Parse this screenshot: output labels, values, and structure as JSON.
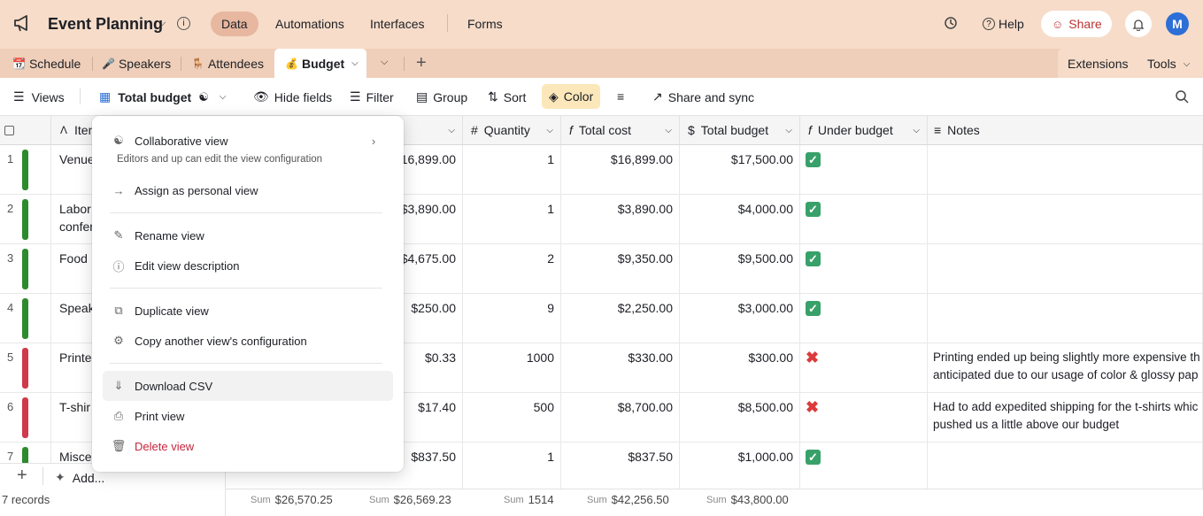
{
  "app": {
    "title": "Event Planning",
    "avatar": "M"
  },
  "topnav": {
    "data": "Data",
    "automations": "Automations",
    "interfaces": "Interfaces",
    "forms": "Forms",
    "help": "Help",
    "share": "Share"
  },
  "tabs": [
    {
      "label": "Schedule",
      "icon": "calendar-icon"
    },
    {
      "label": "Speakers",
      "icon": "microphone-icon"
    },
    {
      "label": "Attendees",
      "icon": "chair-icon"
    },
    {
      "label": "Budget",
      "icon": "money-bag-icon"
    }
  ],
  "tabbar_right": {
    "extensions": "Extensions",
    "tools": "Tools"
  },
  "toolbar": {
    "views": "Views",
    "view_name": "Total budget",
    "hide_fields": "Hide fields",
    "filter": "Filter",
    "group": "Group",
    "sort": "Sort",
    "color": "Color",
    "share_sync": "Share and sync"
  },
  "columns": {
    "item": "Item",
    "quantity": "Quantity",
    "total_cost": "Total cost",
    "total_budget": "Total budget",
    "under_budget": "Under budget",
    "notes": "Notes"
  },
  "rows": [
    {
      "n": "1",
      "item": "Venue",
      "item2": "",
      "color": "#2d8a2d",
      "cost": "$16,899.00",
      "qty": "1",
      "total": "$16,899.00",
      "budget": "$17,500.00",
      "ok": true,
      "notes": "",
      "notes2": ""
    },
    {
      "n": "2",
      "item": "Labor",
      "item2": "confer",
      "color": "#2d8a2d",
      "cost": "$3,890.00",
      "qty": "1",
      "total": "$3,890.00",
      "budget": "$4,000.00",
      "ok": true,
      "notes": "",
      "notes2": ""
    },
    {
      "n": "3",
      "item": "Food",
      "item2": "",
      "color": "#2d8a2d",
      "cost": "$4,675.00",
      "qty": "2",
      "total": "$9,350.00",
      "budget": "$9,500.00",
      "ok": true,
      "notes": "",
      "notes2": ""
    },
    {
      "n": "4",
      "item": "Speak",
      "item2": "",
      "color": "#2d8a2d",
      "cost": "$250.00",
      "qty": "9",
      "total": "$2,250.00",
      "budget": "$3,000.00",
      "ok": true,
      "notes": "",
      "notes2": ""
    },
    {
      "n": "5",
      "item": "Printe",
      "item2": "",
      "color": "#d03a4a",
      "cost": "$0.33",
      "qty": "1000",
      "total": "$330.00",
      "budget": "$300.00",
      "ok": false,
      "notes": "Printing ended up being slightly more expensive th",
      "notes2": "anticipated due to our usage of color & glossy pap"
    },
    {
      "n": "6",
      "item": "T-shir",
      "item2": "",
      "color": "#d03a4a",
      "cost": "$17.40",
      "qty": "500",
      "total": "$8,700.00",
      "budget": "$8,500.00",
      "ok": false,
      "notes": "Had to add expedited shipping for the t-shirts whic",
      "notes2": "pushed us a little above our budget"
    },
    {
      "n": "7",
      "item": "Misce",
      "item2": "",
      "color": "#2d8a2d",
      "cost": "$837.50",
      "qty": "1",
      "total": "$837.50",
      "budget": "$1,000.00",
      "ok": true,
      "notes": "",
      "notes2": ""
    }
  ],
  "footer": {
    "records": "7 records",
    "add": "Add...",
    "sum_label": "Sum",
    "sum_a": "$26,570.25",
    "sum_cost": "$26,569.23",
    "sum_qty": "1514",
    "sum_total": "$42,256.50",
    "sum_budget": "$43,800.00"
  },
  "menu": {
    "collab": "Collaborative view",
    "collab_desc": "Editors and up can edit the view configuration",
    "assign": "Assign as personal view",
    "rename": "Rename view",
    "edit_desc": "Edit view description",
    "duplicate": "Duplicate view",
    "copy_config": "Copy another view's configuration",
    "download": "Download CSV",
    "print": "Print view",
    "delete": "Delete view"
  },
  "colors": {
    "top": "#f6dcc9",
    "tabbar": "#efcfba",
    "accent": "#e7b7a0",
    "delete": "#c5263d",
    "avatar": "#2d6fd6"
  }
}
